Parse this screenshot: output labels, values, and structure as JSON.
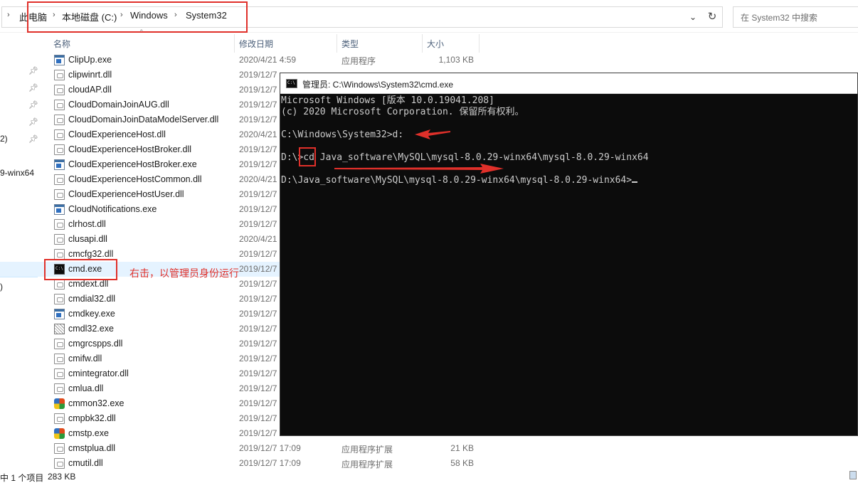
{
  "address_bar": {
    "crumbs": [
      "此电脑",
      "本地磁盘 (C:)",
      "Windows",
      "System32"
    ],
    "search_placeholder": "在 System32 中搜索"
  },
  "nav_fragments": [
    "2)",
    "9-winx64",
    ")",
    ")"
  ],
  "columns": {
    "name": "名称",
    "date": "修改日期",
    "type": "类型",
    "size": "大小"
  },
  "files": [
    {
      "name": "ClipUp.exe",
      "date": "2020/4/21 4:59",
      "type": "应用程序",
      "size": "1,103 KB",
      "icon": "exe-icon"
    },
    {
      "name": "clipwinrt.dll",
      "date": "2019/12/7",
      "type": "",
      "size": "",
      "icon": "dll-icon"
    },
    {
      "name": "cloudAP.dll",
      "date": "2019/12/7",
      "type": "",
      "size": "",
      "icon": "dll-icon"
    },
    {
      "name": "CloudDomainJoinAUG.dll",
      "date": "2019/12/7",
      "type": "",
      "size": "",
      "icon": "dll-icon"
    },
    {
      "name": "CloudDomainJoinDataModelServer.dll",
      "date": "2019/12/7",
      "type": "",
      "size": "",
      "icon": "dll-icon"
    },
    {
      "name": "CloudExperienceHost.dll",
      "date": "2020/4/21",
      "type": "",
      "size": "",
      "icon": "dll-icon"
    },
    {
      "name": "CloudExperienceHostBroker.dll",
      "date": "2019/12/7",
      "type": "",
      "size": "",
      "icon": "dll-icon"
    },
    {
      "name": "CloudExperienceHostBroker.exe",
      "date": "2019/12/7",
      "type": "",
      "size": "",
      "icon": "exe-icon"
    },
    {
      "name": "CloudExperienceHostCommon.dll",
      "date": "2020/4/21",
      "type": "",
      "size": "",
      "icon": "dll-icon"
    },
    {
      "name": "CloudExperienceHostUser.dll",
      "date": "2019/12/7",
      "type": "",
      "size": "",
      "icon": "dll-icon"
    },
    {
      "name": "CloudNotifications.exe",
      "date": "2019/12/7",
      "type": "",
      "size": "",
      "icon": "exe-icon"
    },
    {
      "name": "clrhost.dll",
      "date": "2019/12/7",
      "type": "",
      "size": "",
      "icon": "dll-icon"
    },
    {
      "name": "clusapi.dll",
      "date": "2020/4/21",
      "type": "",
      "size": "",
      "icon": "dll-icon"
    },
    {
      "name": "cmcfg32.dll",
      "date": "2019/12/7",
      "type": "",
      "size": "",
      "icon": "dll-icon"
    },
    {
      "name": "cmd.exe",
      "date": "2019/12/7",
      "type": "",
      "size": "",
      "icon": "cmd-icon",
      "selected": true
    },
    {
      "name": "cmdext.dll",
      "date": "2019/12/7",
      "type": "",
      "size": "",
      "icon": "dll-icon"
    },
    {
      "name": "cmdial32.dll",
      "date": "2019/12/7",
      "type": "",
      "size": "",
      "icon": "dll-icon"
    },
    {
      "name": "cmdkey.exe",
      "date": "2019/12/7",
      "type": "",
      "size": "",
      "icon": "exe-icon"
    },
    {
      "name": "cmdl32.exe",
      "date": "2019/12/7",
      "type": "",
      "size": "",
      "icon": "cert-icon"
    },
    {
      "name": "cmgrcspps.dll",
      "date": "2019/12/7",
      "type": "",
      "size": "",
      "icon": "dll-icon"
    },
    {
      "name": "cmifw.dll",
      "date": "2019/12/7",
      "type": "",
      "size": "",
      "icon": "dll-icon"
    },
    {
      "name": "cmintegrator.dll",
      "date": "2019/12/7",
      "type": "",
      "size": "",
      "icon": "dll-icon"
    },
    {
      "name": "cmlua.dll",
      "date": "2019/12/7",
      "type": "",
      "size": "",
      "icon": "dll-icon"
    },
    {
      "name": "cmmon32.exe",
      "date": "2019/12/7",
      "type": "",
      "size": "",
      "icon": "color-app-icon"
    },
    {
      "name": "cmpbk32.dll",
      "date": "2019/12/7",
      "type": "",
      "size": "",
      "icon": "dll-icon"
    },
    {
      "name": "cmstp.exe",
      "date": "2019/12/7",
      "type": "",
      "size": "",
      "icon": "color-app-icon"
    },
    {
      "name": "cmstplua.dll",
      "date": "2019/12/7 17:09",
      "type": "应用程序扩展",
      "size": "21 KB",
      "icon": "dll-icon"
    },
    {
      "name": "cmutil.dll",
      "date": "2019/12/7 17:09",
      "type": "应用程序扩展",
      "size": "58 KB",
      "icon": "dll-icon"
    }
  ],
  "annotation": {
    "text": "右击，以管理员身份运行",
    "color": "#e0302a"
  },
  "status_bar": {
    "selection": "中 1 个项目",
    "size": "283 KB"
  },
  "cmd_window": {
    "title": "管理员: C:\\Windows\\System32\\cmd.exe",
    "lines": [
      "Microsoft Windows [版本 10.0.19041.208]",
      "(c) 2020 Microsoft Corporation. 保留所有权利。",
      "",
      "C:\\Windows\\System32>d:",
      "",
      "D:\\>cd Java_software\\MySQL\\mysql-8.0.29-winx64\\mysql-8.0.29-winx64",
      "",
      "D:\\Java_software\\MySQL\\mysql-8.0.29-winx64\\mysql-8.0.29-winx64>"
    ]
  }
}
